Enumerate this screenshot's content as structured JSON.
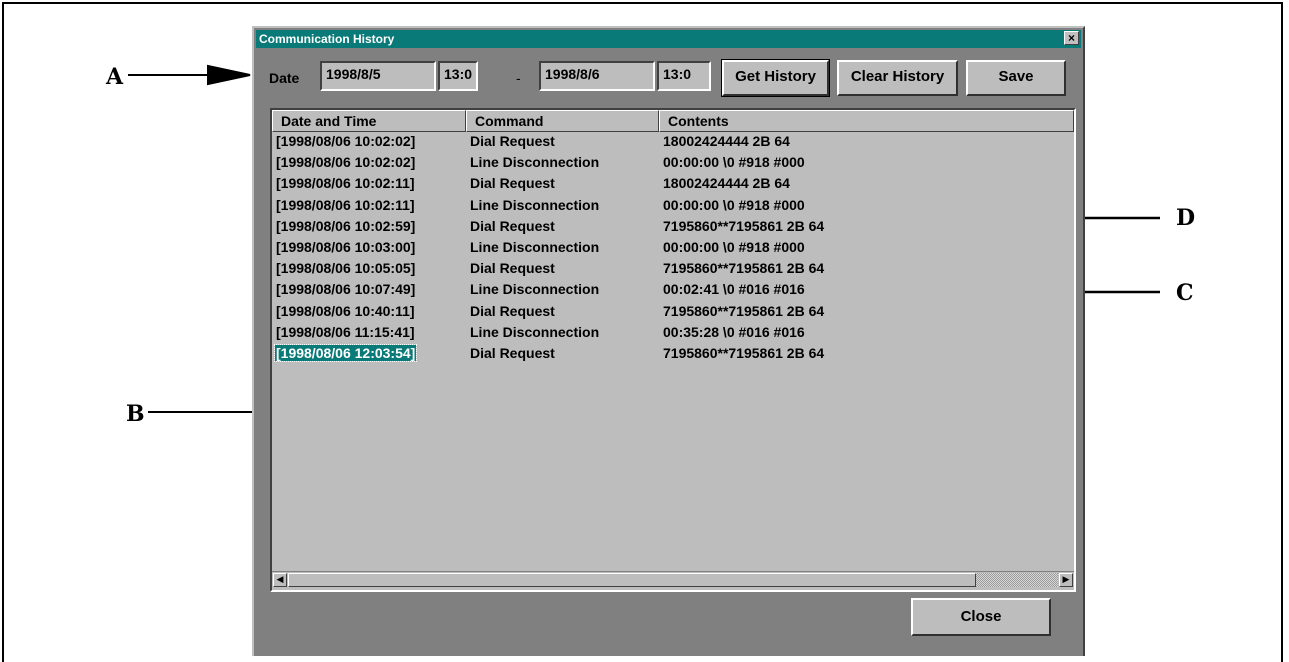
{
  "callouts": {
    "a": "A",
    "b": "B",
    "c": "C",
    "d": "D"
  },
  "window": {
    "title": "Communication History",
    "close_glyph": "×"
  },
  "toolbar": {
    "date_label": "Date",
    "from_date": "1998/8/5",
    "from_time": "13:0",
    "separator": "-",
    "to_date": "1998/8/6",
    "to_time": "13:0",
    "get_history": "Get History",
    "clear_history": "Clear History",
    "save": "Save"
  },
  "table": {
    "columns": [
      "Date and Time",
      "Command",
      "Contents"
    ],
    "rows": [
      [
        "[1998/08/06 10:02:02]",
        "Dial Request",
        "18002424444 2B 64"
      ],
      [
        "[1998/08/06 10:02:02]",
        "Line Disconnection",
        "00:00:00 \\0 #918 #000"
      ],
      [
        "[1998/08/06 10:02:11]",
        "Dial Request",
        "18002424444 2B 64"
      ],
      [
        "[1998/08/06 10:02:11]",
        "Line Disconnection",
        "00:00:00 \\0 #918 #000"
      ],
      [
        "[1998/08/06 10:02:59]",
        "Dial Request",
        "7195860**7195861 2B 64"
      ],
      [
        "[1998/08/06 10:03:00]",
        "Line Disconnection",
        "00:00:00 \\0 #918 #000"
      ],
      [
        "[1998/08/06 10:05:05]",
        "Dial Request",
        "7195860**7195861 2B 64"
      ],
      [
        "[1998/08/06 10:07:49]",
        "Line Disconnection",
        "00:02:41 \\0 #016 #016"
      ],
      [
        "[1998/08/06 10:40:11]",
        "Dial Request",
        "7195860**7195861 2B 64"
      ],
      [
        "[1998/08/06 11:15:41]",
        "Line Disconnection",
        "00:35:28 \\0 #016 #016"
      ],
      [
        "[1998/08/06 12:03:54]",
        "Dial Request",
        "7195860**7195861 2B 64"
      ]
    ],
    "selected_row": 10
  },
  "footer": {
    "close": "Close"
  },
  "colors": {
    "title_bar": "#0a7a78",
    "dialog_bg": "#808080",
    "list_bg": "#bdbdbd"
  }
}
